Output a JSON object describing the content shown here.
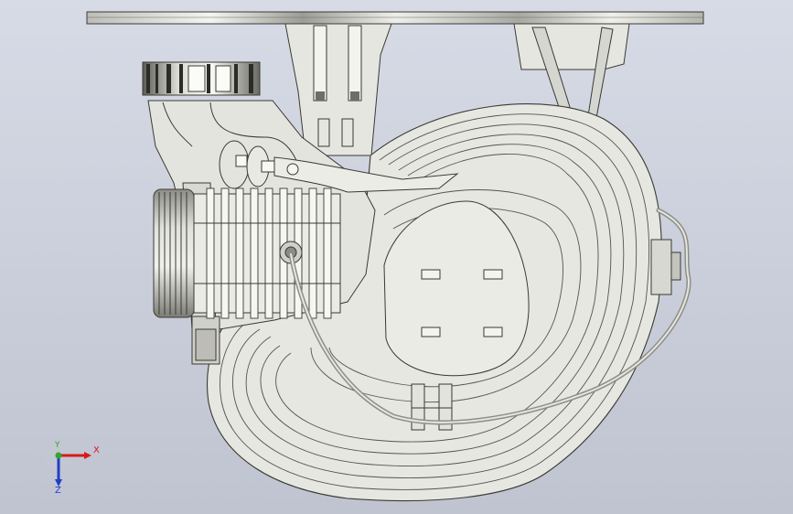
{
  "viewport": {
    "background": "#cdd1dc",
    "model_fill": "#e9e9e4",
    "model_stroke": "#3a3a34",
    "cable_color": "#9a9a92"
  },
  "triad": {
    "x_label": "X",
    "y_label": "Y",
    "z_label": "Z",
    "x_color": "#d8191b",
    "y_color": "#2fa82f",
    "z_color": "#1f3ec9"
  }
}
